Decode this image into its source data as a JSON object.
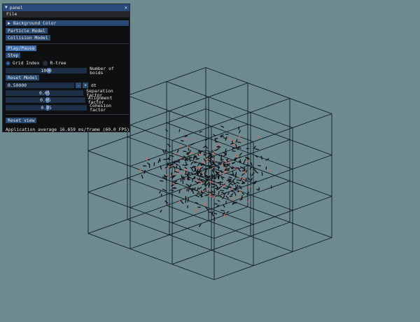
{
  "window": {
    "title": "panel",
    "close_icon": "close-icon"
  },
  "menu": {
    "file": "File"
  },
  "headers": {
    "background_color": "Background Color",
    "particle_model": "Particle Model",
    "collision_model": "Collision Model"
  },
  "controls": {
    "play_pause": "Play/Pause",
    "step": "Step",
    "grid_index": "Grid Index",
    "rtree": "R-tree",
    "selected_index": "Grid Index",
    "num_boids_value": "1000",
    "num_boids_label": "Number of boids",
    "reset_model": "Reset Model",
    "dt_value": "0.50000",
    "dt_minus": "-",
    "dt_plus": "+",
    "dt_label": "dt",
    "separation_value": "0.05",
    "separation_label": "Separation factor",
    "alignment_value": "0.05",
    "alignment_label": "Alignment factor",
    "cohesion_value": "0.05",
    "cohesion_label": "Cohesion factor",
    "reset_view": "Reset view"
  },
  "status": "Application average 16.659 ms/frame (60.0 FPS)",
  "colors": {
    "background": "#6e8a91",
    "panel": "#0e0f11",
    "accent": "#294a7a",
    "boid_dark": "#111418",
    "boid_red": "#c96d62"
  }
}
